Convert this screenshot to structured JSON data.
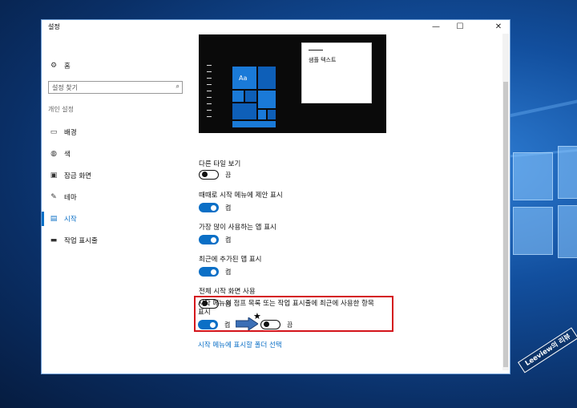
{
  "window": {
    "title": "설정",
    "controls": [
      "—",
      "☐",
      "✕"
    ]
  },
  "sidebar": {
    "home_label": "홈",
    "search_placeholder": "설정 찾기",
    "section": "개인 설정",
    "items": [
      {
        "label": "배경",
        "icon": "image-icon"
      },
      {
        "label": "색",
        "icon": "palette-icon"
      },
      {
        "label": "잠금 화면",
        "icon": "lock-screen-icon"
      },
      {
        "label": "테마",
        "icon": "theme-icon"
      },
      {
        "label": "시작",
        "icon": "start-icon",
        "active": true
      },
      {
        "label": "작업 표시줄",
        "icon": "taskbar-icon"
      }
    ]
  },
  "preview": {
    "sample_text": "샘플 텍스트",
    "tile_label": "Aa"
  },
  "settings": [
    {
      "label": "다른 타일 보기",
      "state": "끔",
      "on": false
    },
    {
      "label": "때때로 시작 메뉴에 제안 표시",
      "state": "켬",
      "on": true
    },
    {
      "label": "가장 많이 사용하는 앱 표시",
      "state": "켬",
      "on": true
    },
    {
      "label": "최근에 추가된 앱 표시",
      "state": "켬",
      "on": true
    },
    {
      "label": "전체 시작 화면 사용",
      "state": "끔",
      "on": false
    }
  ],
  "highlighted": {
    "label_line1": "시작 메뉴의 점프 목록 또는 작업 표시줄에 최근에 사용한 항목",
    "label_line2": "표시",
    "before_state": "켬",
    "after_state": "끔",
    "star": "★"
  },
  "link": "시작 메뉴에 표시할 폴더 선택",
  "watermark": "Leeview의 리뷰",
  "colors": {
    "accent": "#0b6fc6",
    "highlight_border": "#d4141b"
  }
}
